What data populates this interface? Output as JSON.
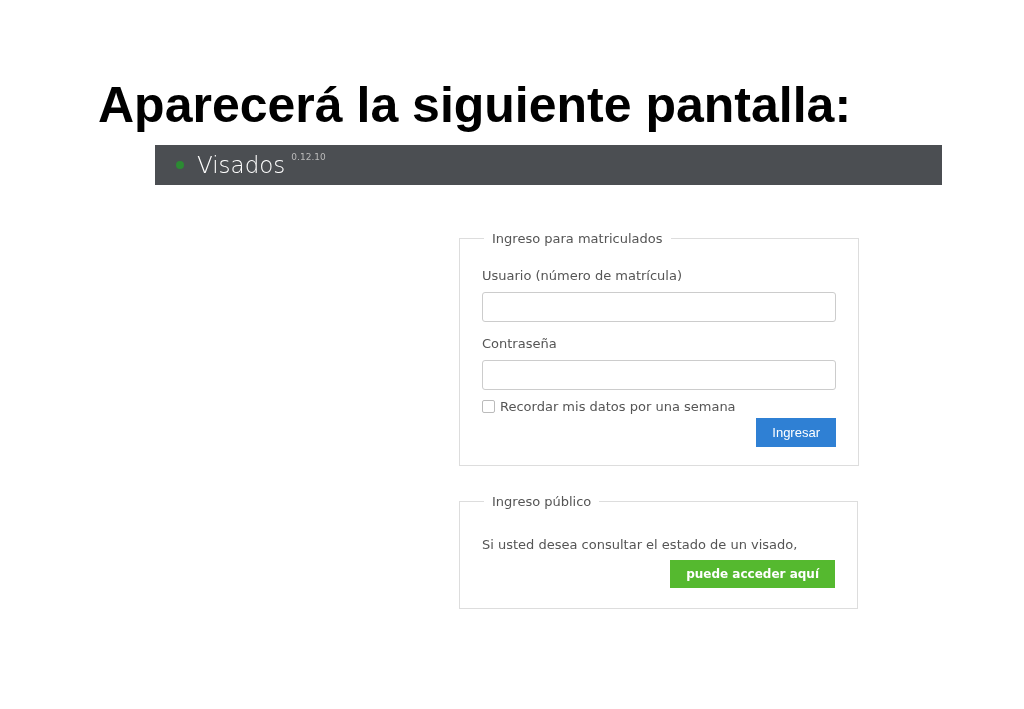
{
  "slide_title": "Aparecerá la siguiente pantalla:",
  "app_bar": {
    "title": "Visados",
    "version": "0.12.10"
  },
  "member_login": {
    "legend": "Ingreso para matriculados",
    "fields": [
      {
        "label": "Usuario (número de matrícula)"
      },
      {
        "label": "Contraseña"
      }
    ],
    "remember": {
      "label": "Recordar mis datos por una semana",
      "checked": false
    },
    "button": "Ingresar"
  },
  "public_access": {
    "legend": "Ingreso público",
    "text": "Si usted desea consultar el estado de un visado,",
    "button": "puede acceder aquí"
  }
}
